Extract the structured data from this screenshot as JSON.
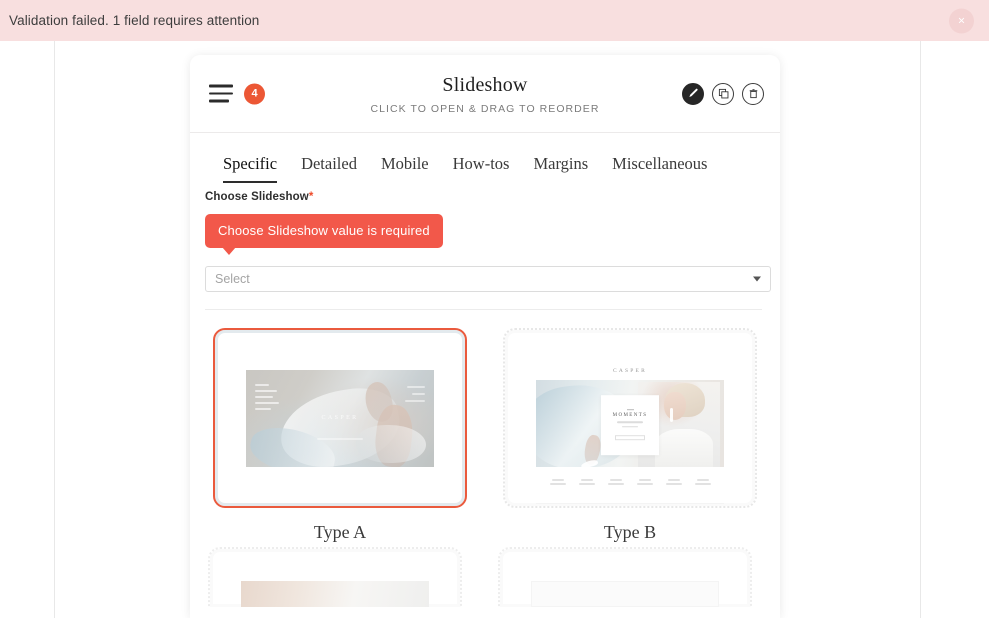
{
  "banner": {
    "message": "Validation failed. 1 field requires attention",
    "close_label": "×",
    "background": "#f8dfdf"
  },
  "panel": {
    "badge_count": "4",
    "title": "Slideshow",
    "subtitle": "CLICK TO OPEN & DRAG TO REORDER",
    "actions": [
      {
        "name": "edit-button",
        "icon": "pencil-icon"
      },
      {
        "name": "duplicate-button",
        "icon": "copy-icon"
      },
      {
        "name": "delete-button",
        "icon": "trash-icon"
      }
    ]
  },
  "tabs": [
    {
      "label": "Specific",
      "active": true
    },
    {
      "label": "Detailed",
      "active": false
    },
    {
      "label": "Mobile",
      "active": false
    },
    {
      "label": "How-tos",
      "active": false
    },
    {
      "label": "Margins",
      "active": false
    },
    {
      "label": "Miscellaneous",
      "active": false
    }
  ],
  "field": {
    "label": "Choose Slideshow",
    "required_marker": "*",
    "error_message": "Choose Slideshow value is required",
    "select_placeholder": "Select",
    "select_value": ""
  },
  "cards": [
    {
      "label": "Type A",
      "selected": true
    },
    {
      "label": "Type B",
      "selected": false
    }
  ],
  "preview_type_a": {
    "brand": "CASPER"
  },
  "preview_type_b": {
    "logo": "CASPER",
    "card_title": "MOMENTS"
  },
  "colors": {
    "accent": "#ec5735",
    "error": "#f2584a",
    "banner_bg": "#f8dfdf",
    "selected_border": "#ea5a3d",
    "text": "#2f2f2f"
  }
}
